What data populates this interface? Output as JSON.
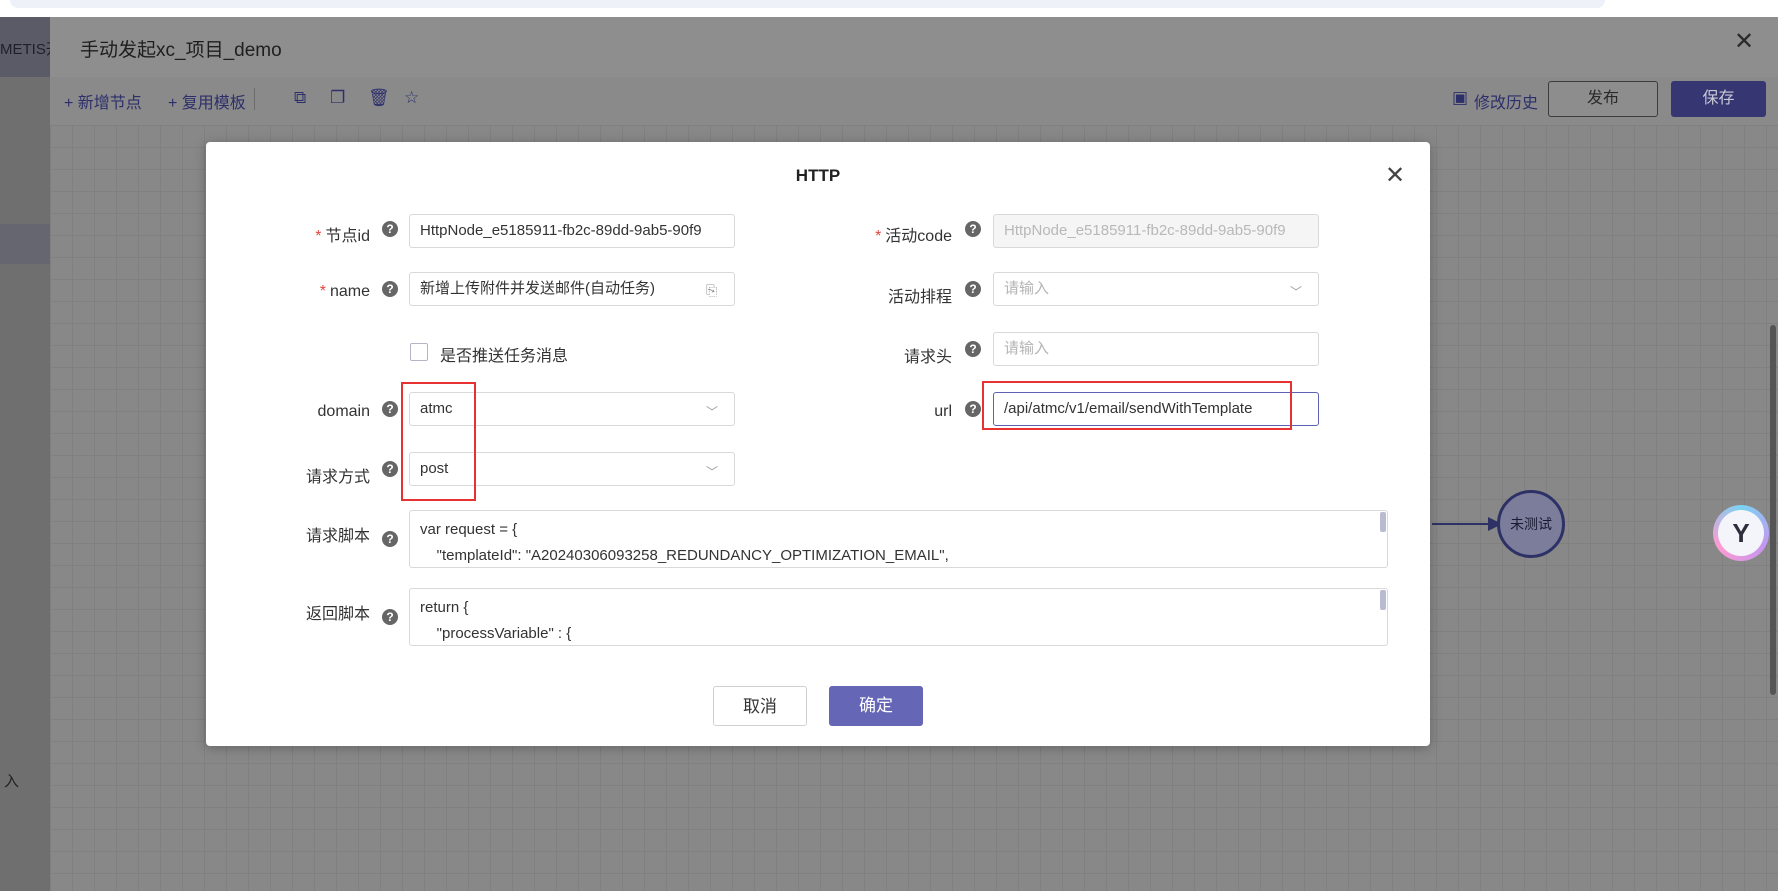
{
  "app": {
    "left_title": "METIS开",
    "left_input_hint": "入"
  },
  "editor": {
    "title": "手动发起xc_项目_demo",
    "toolbar": {
      "add_node": "+ 新增节点",
      "reuse_template": "+ 复用模板",
      "history": "修改历史",
      "publish": "发布",
      "save": "保存"
    },
    "node": {
      "status": "未测试"
    }
  },
  "modal": {
    "title": "HTTP",
    "fields": {
      "node_id": {
        "label": "节点id",
        "value": "HttpNode_e5185911-fb2c-89dd-9ab5-90f9"
      },
      "activity_code": {
        "label": "活动code",
        "value": "HttpNode_e5185911-fb2c-89dd-9ab5-90f9"
      },
      "name": {
        "label": "name",
        "value": "新增上传附件并发送邮件(自动任务)"
      },
      "activity_sort": {
        "label": "活动排程",
        "placeholder": "请输入"
      },
      "push_message": {
        "label": "是否推送任务消息",
        "checked": false
      },
      "request_header": {
        "label": "请求头",
        "placeholder": "请输入"
      },
      "domain": {
        "label": "domain",
        "value": "atmc"
      },
      "url": {
        "label": "url",
        "value": "/api/atmc/v1/email/sendWithTemplate"
      },
      "method": {
        "label": "请求方式",
        "value": "post"
      },
      "request_script": {
        "label": "请求脚本",
        "lines": [
          "var request = {",
          "    \"templateId\": \"A20240306093258_REDUNDANCY_OPTIMIZATION_EMAIL\","
        ]
      },
      "return_script": {
        "label": "返回脚本",
        "lines": [
          "return {",
          "    \"processVariable\" : {"
        ]
      }
    },
    "buttons": {
      "cancel": "取消",
      "confirm": "确定"
    }
  }
}
